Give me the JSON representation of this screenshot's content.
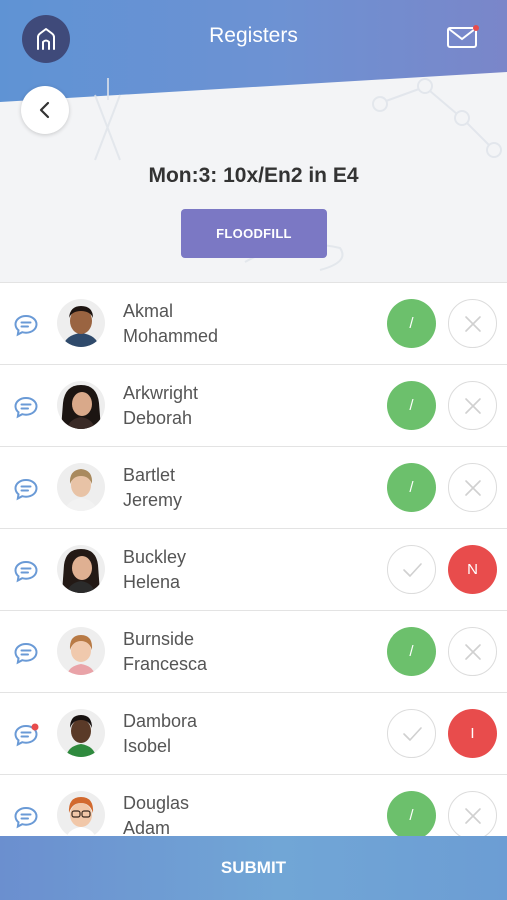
{
  "header": {
    "title": "Registers",
    "class_title": "Mon:3: 10x/En2 in E4",
    "floodfill_label": "FLOODFILL"
  },
  "colors": {
    "present": "#6cc06c",
    "absent": "#e84c4c",
    "accent": "#7b78c4",
    "header_blue": "#6a8fd0"
  },
  "students": [
    {
      "first": "Akmal",
      "second": "Mohammed",
      "present_mark": "/",
      "absent_mark": "",
      "status": "present",
      "has_comment_alert": false
    },
    {
      "first": "Arkwright",
      "second": "Deborah",
      "present_mark": "/",
      "absent_mark": "",
      "status": "present",
      "has_comment_alert": false
    },
    {
      "first": "Bartlet",
      "second": "Jeremy",
      "present_mark": "/",
      "absent_mark": "",
      "status": "present",
      "has_comment_alert": false
    },
    {
      "first": "Buckley",
      "second": "Helena",
      "present_mark": "",
      "absent_mark": "N",
      "status": "absent",
      "has_comment_alert": false
    },
    {
      "first": "Burnside",
      "second": "Francesca",
      "present_mark": "/",
      "absent_mark": "",
      "status": "present",
      "has_comment_alert": false
    },
    {
      "first": "Dambora",
      "second": "Isobel",
      "present_mark": "",
      "absent_mark": "I",
      "status": "absent",
      "has_comment_alert": true
    },
    {
      "first": "Douglas",
      "second": "Adam",
      "present_mark": "/",
      "absent_mark": "",
      "status": "present",
      "has_comment_alert": false
    }
  ],
  "footer": {
    "submit_label": "SUBMIT"
  }
}
